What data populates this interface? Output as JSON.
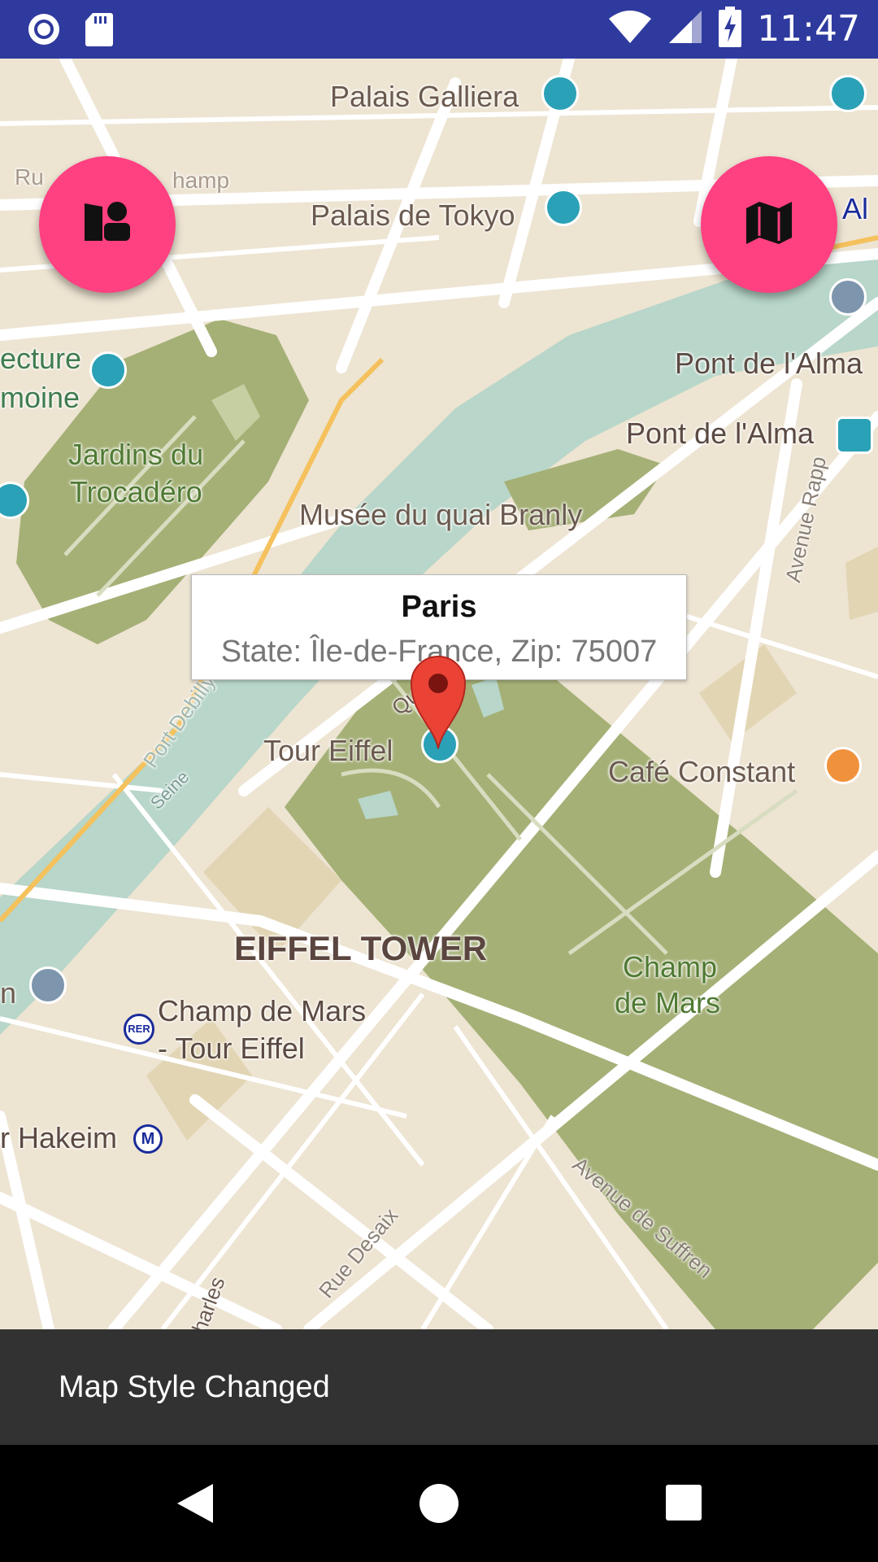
{
  "status_bar": {
    "time": "11:47",
    "icons": [
      "sync-icon",
      "sd-card-icon",
      "wifi-icon",
      "signal-icon",
      "battery-charging-icon"
    ]
  },
  "map": {
    "labels": {
      "palais_galliera": "Palais Galliera",
      "palais_tokyo": "Palais de Tokyo",
      "pont_alma_1": "Pont de l'Alma",
      "pont_alma_2": "Pont de l'Alma",
      "architecture": "ecture",
      "patrimoine": "moine",
      "jardins": "Jardins du",
      "trocadero": "Trocadéro",
      "musee": "Musée du quai Branly",
      "avenue_rapp": "Avenue Rapp",
      "quai_branly": "Quai Bran",
      "tour_eiffel": "Tour Eiffel",
      "cafe_constant": "Café Constant",
      "eiffel_tower": "EIFFEL TOWER",
      "champ_mars_park_1": "Champ",
      "champ_mars_park_2": "de Mars",
      "champ_mars_station_1": "Champ de Mars",
      "champ_mars_station_2": "- Tour Eiffel",
      "bir_hakeim": "r Hakeim",
      "rue_desaix": "Rue Desaix",
      "avenue_suffren": "Avenue de Suffren",
      "charles": "harles",
      "seine": "Seine",
      "port_debilly": "Port Debilly",
      "rue_champ": "Ru",
      "champ_part": "hamp",
      "alma_metro": "Al",
      "left_h": "n",
      "rer": "RER",
      "metro_m": "M"
    }
  },
  "fab_left": {
    "icon": "person-pin-icon"
  },
  "fab_right": {
    "icon": "map-icon"
  },
  "info_window": {
    "title": "Paris",
    "snippet": "State: Île-de-France, Zip: 75007"
  },
  "snackbar": {
    "message": "Map Style Changed"
  },
  "nav_bar": {
    "back": "back-icon",
    "home": "home-icon",
    "recents": "recents-icon"
  },
  "colors": {
    "status_bar": "#2f3a9e",
    "fab": "#ff4081",
    "map_land": "#ede4d2",
    "park": "#a5b076",
    "water": "#b8d6c9",
    "snackbar": "#323232",
    "marker": "#ea4335"
  }
}
